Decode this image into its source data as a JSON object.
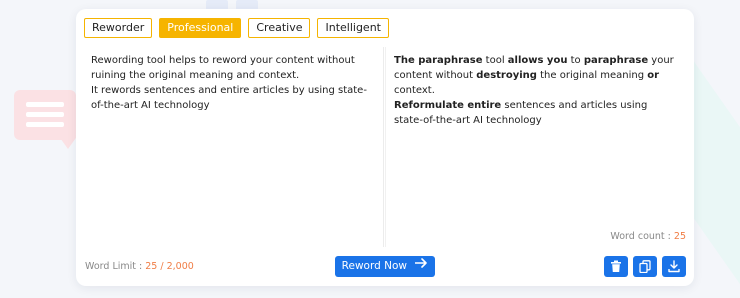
{
  "tabs": [
    {
      "label": "Reworder",
      "active": false
    },
    {
      "label": "Professional",
      "active": true
    },
    {
      "label": "Creative",
      "active": false
    },
    {
      "label": "Intelligent",
      "active": false
    }
  ],
  "input": {
    "text": "Rewording tool helps to reword your content without ruining the original meaning and context.\nIt rewords sentences and entire articles by using state-of-the-art AI technology"
  },
  "output": {
    "segments": [
      {
        "text": "The paraphrase",
        "bold": true
      },
      {
        "text": " tool ",
        "bold": false
      },
      {
        "text": "allows you",
        "bold": true
      },
      {
        "text": " to ",
        "bold": false
      },
      {
        "text": "paraphrase",
        "bold": true
      },
      {
        "text": " your content without ",
        "bold": false
      },
      {
        "text": "destroying",
        "bold": true
      },
      {
        "text": " the original meaning ",
        "bold": false
      },
      {
        "text": "or",
        "bold": true
      },
      {
        "text": " context.\n",
        "bold": false
      },
      {
        "text": "Reformulate entire",
        "bold": true
      },
      {
        "text": " sentences and articles using state-of-the-art AI technology",
        "bold": false
      }
    ]
  },
  "word_count": {
    "label": "Word count :",
    "value": "25"
  },
  "word_limit": {
    "label": "Word Limit :",
    "current": "25",
    "separator": "/",
    "max": "2,000"
  },
  "actions": {
    "reword_label": "Reword Now",
    "delete_icon": "trash-icon",
    "copy_icon": "copy-icon",
    "download_icon": "download-icon"
  },
  "colors": {
    "accent": "#f6b400",
    "primary": "#1a73e8",
    "count": "#f07d45"
  }
}
